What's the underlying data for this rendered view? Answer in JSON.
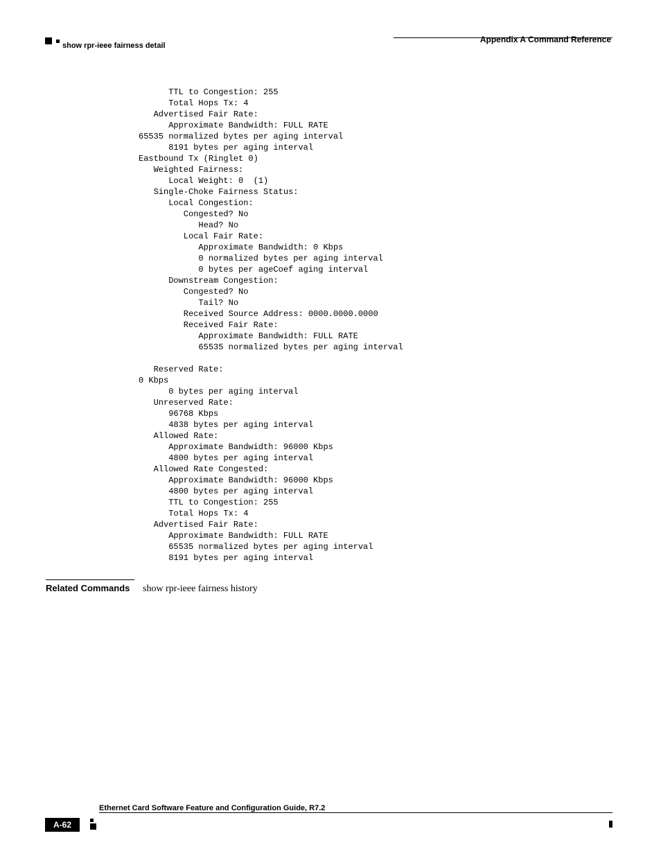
{
  "header": {
    "right": "Appendix A Command Reference",
    "left": "show rpr-ieee fairness detail"
  },
  "code": "      TTL to Congestion: 255\n      Total Hops Tx: 4\n   Advertised Fair Rate:\n      Approximate Bandwidth: FULL RATE\n65535 normalized bytes per aging interval\n      8191 bytes per aging interval\nEastbound Tx (Ringlet 0)\n   Weighted Fairness:\n      Local Weight: 0  (1)\n   Single-Choke Fairness Status:\n      Local Congestion:\n         Congested? No\n            Head? No\n         Local Fair Rate:\n            Approximate Bandwidth: 0 Kbps\n            0 normalized bytes per aging interval\n            0 bytes per ageCoef aging interval\n      Downstream Congestion:\n         Congested? No\n            Tail? No\n         Received Source Address: 0000.0000.0000\n         Received Fair Rate:\n            Approximate Bandwidth: FULL RATE\n            65535 normalized bytes per aging interval\n\n   Reserved Rate:\n0 Kbps\n      0 bytes per aging interval\n   Unreserved Rate:\n      96768 Kbps\n      4838 bytes per aging interval\n   Allowed Rate:\n      Approximate Bandwidth: 96000 Kbps\n      4800 bytes per aging interval\n   Allowed Rate Congested:\n      Approximate Bandwidth: 96000 Kbps\n      4800 bytes per aging interval\n      TTL to Congestion: 255\n      Total Hops Tx: 4\n   Advertised Fair Rate:\n      Approximate Bandwidth: FULL RATE\n      65535 normalized bytes per aging interval\n      8191 bytes per aging interval",
  "related": {
    "label": "Related Commands",
    "text": "show rpr-ieee fairness history"
  },
  "footer": {
    "title": "Ethernet Card Software Feature and Configuration Guide, R7.2",
    "pagenum": "A-62"
  }
}
